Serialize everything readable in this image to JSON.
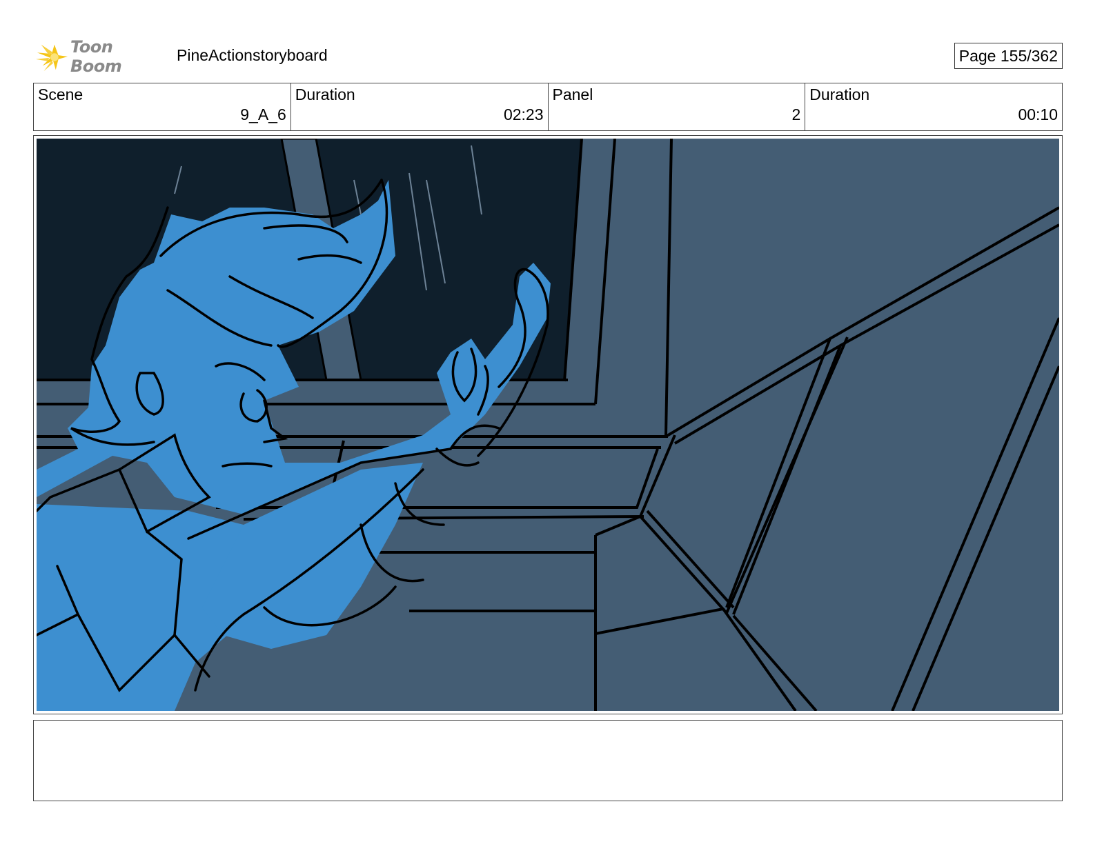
{
  "header": {
    "logo_text": "Toon Boom",
    "project_title": "PineActionstoryboard",
    "page_label": "Page 155/362"
  },
  "info": {
    "scene_label": "Scene",
    "scene_value": "9_A_6",
    "scene_duration_label": "Duration",
    "scene_duration_value": "02:23",
    "panel_label": "Panel",
    "panel_value": "2",
    "panel_duration_label": "Duration",
    "panel_duration_value": "00:10"
  },
  "colors": {
    "logo_yellow": "#f5c518",
    "night_sky": "#0f1f2c",
    "wall": "#445d74",
    "character_blue": "#3d8fd0"
  },
  "notes": {
    "text": ""
  }
}
